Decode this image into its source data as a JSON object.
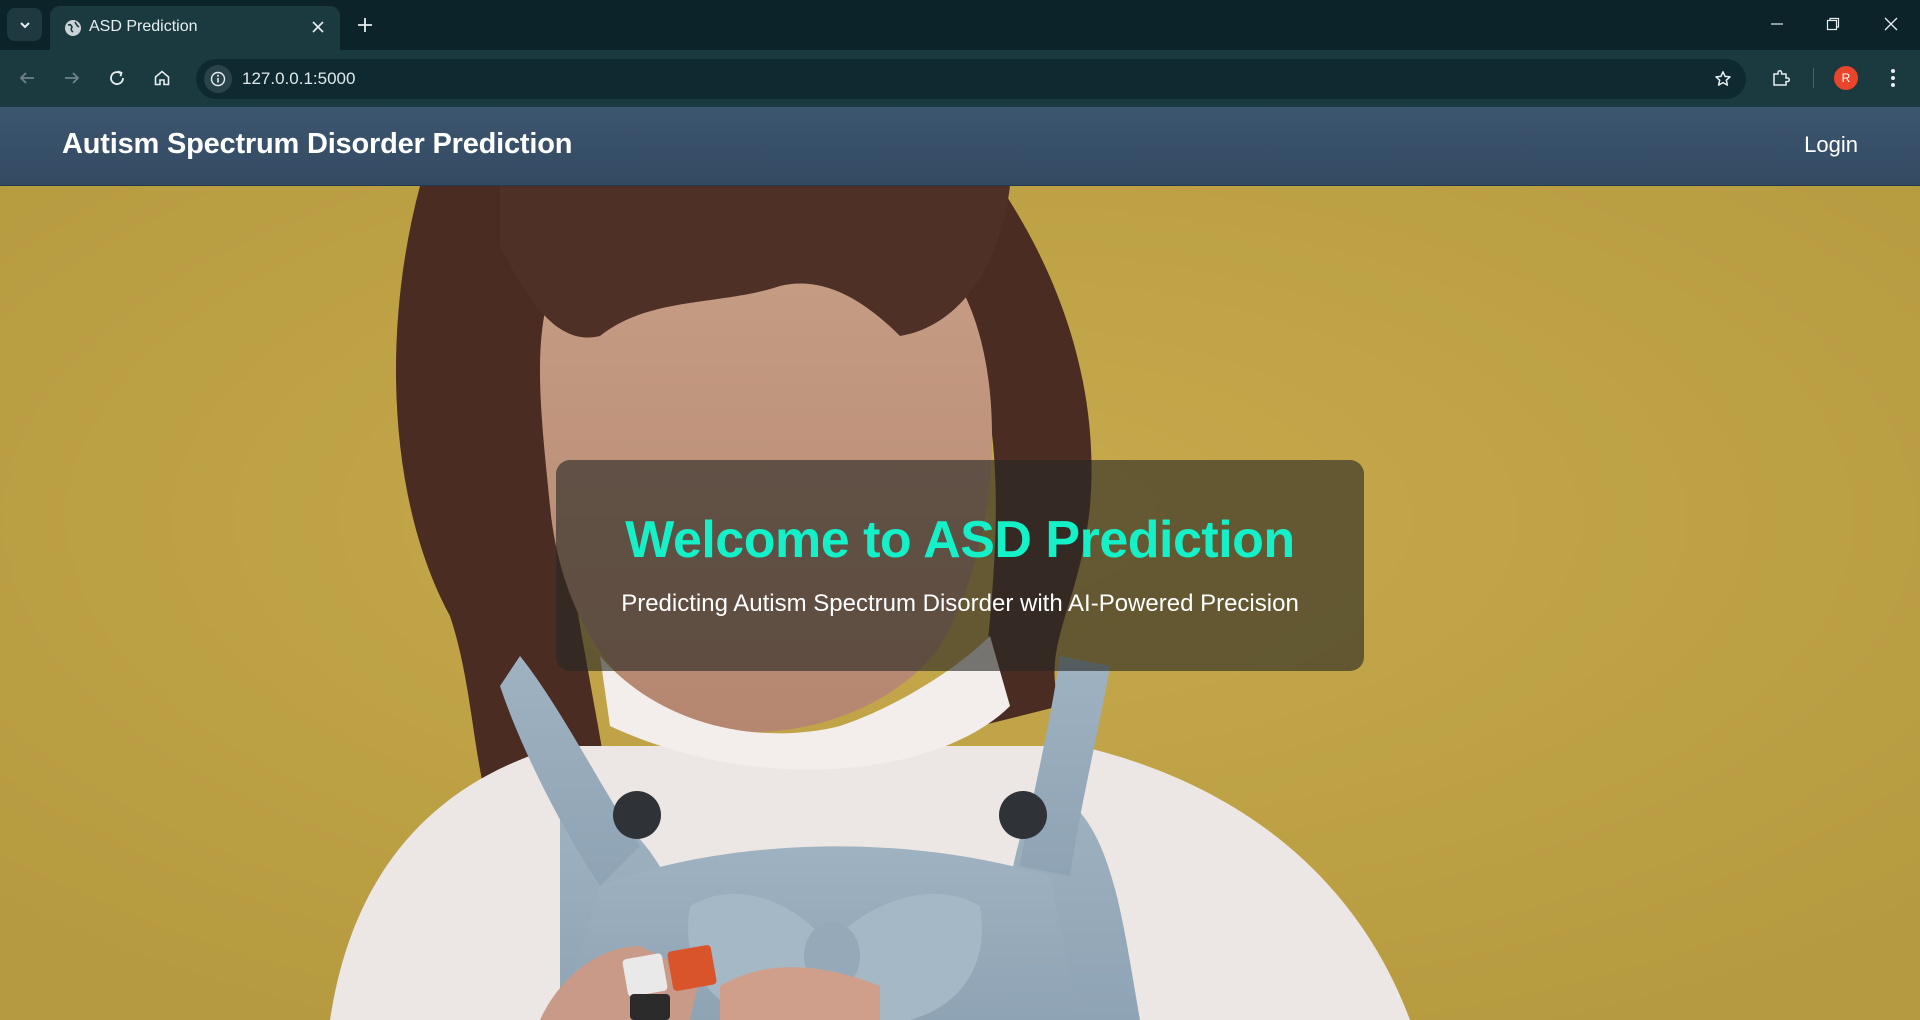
{
  "browser": {
    "tab_title": "ASD Prediction",
    "url": "127.0.0.1:5000",
    "profile_initial": "R"
  },
  "navbar": {
    "brand": "Autism Spectrum Disorder Prediction",
    "login_label": "Login"
  },
  "hero": {
    "title": "Welcome to ASD Prediction",
    "subtitle": "Predicting Autism Spectrum Disorder with AI-Powered Precision"
  },
  "colors": {
    "navbar": "#3a5269",
    "hero_background": "#bea245",
    "accent_title": "#14f0c8",
    "browser_frame": "#0b2329"
  }
}
